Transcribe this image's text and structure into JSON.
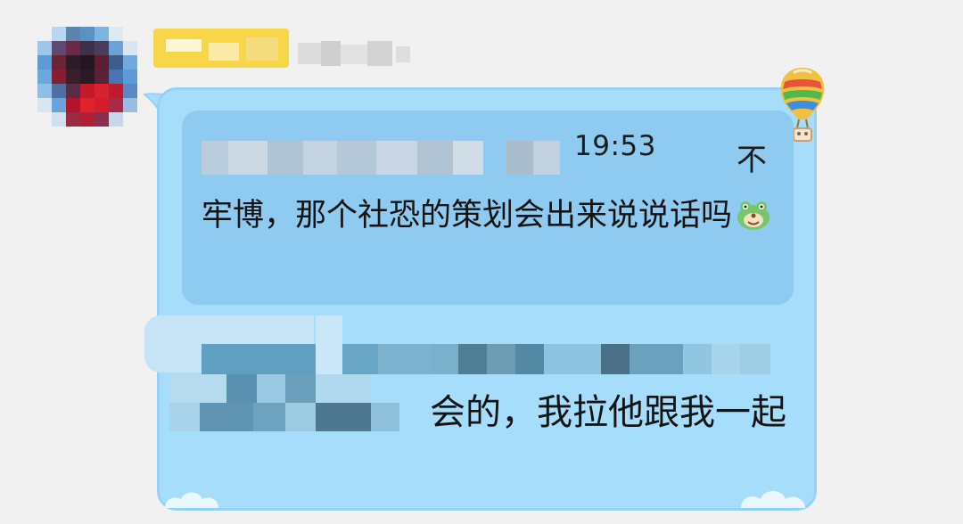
{
  "sender": {
    "avatar_icon": "user-avatar-redacted",
    "name_redacted": true
  },
  "message": {
    "quote": {
      "time": "19:53",
      "action_glyph": "不",
      "text": "牢博，那个社恐的策划会出来说说话吗",
      "emoji_icon": "frog-emoji-icon"
    },
    "reply": {
      "text_line": "会的，我拉他跟我一起"
    }
  },
  "decorations": {
    "balloon_icon": "hot-air-balloon-icon",
    "bubble_color": "#a6ddfb",
    "quote_color": "#8fcbf1",
    "name_badge_color": "#f7d64a"
  }
}
